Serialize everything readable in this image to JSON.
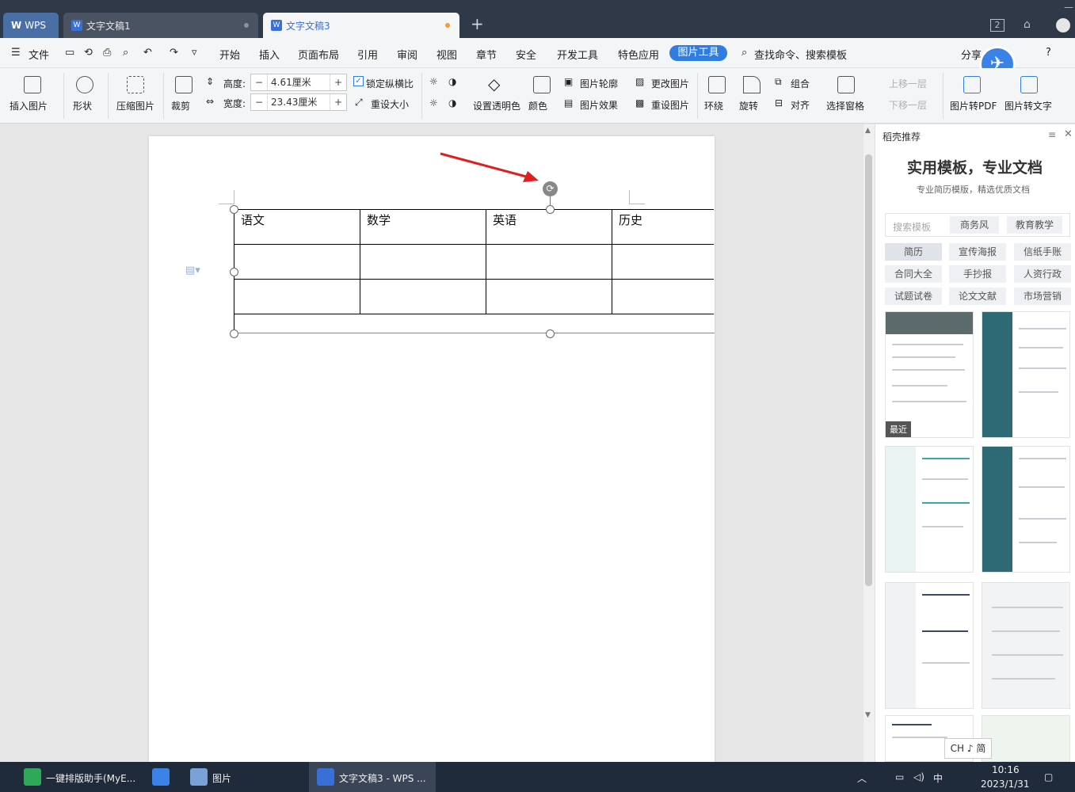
{
  "tabs": [
    {
      "label": "WPS"
    },
    {
      "label": "文字文稿1"
    },
    {
      "label": "文字文稿3"
    }
  ],
  "title_right": {
    "page_count": "2"
  },
  "menu": {
    "file": "文件",
    "items": [
      "开始",
      "插入",
      "页面布局",
      "引用",
      "审阅",
      "视图",
      "章节",
      "安全",
      "开发工具",
      "特色应用"
    ],
    "active": "图片工具",
    "search": "查找命令、搜索模板",
    "share": "分享",
    "help": "?"
  },
  "ribbon": {
    "insert_picture": "插入图片",
    "shape": "形状",
    "compress": "压缩图片",
    "crop": "裁剪",
    "height_label": "高度:",
    "height_value": "4.61厘米",
    "width_label": "宽度:",
    "width_value": "23.43厘米",
    "lock_ratio": "锁定纵横比",
    "reset_size": "重设大小",
    "transparency": "设置透明色",
    "color": "颜色",
    "outline": "图片轮廓",
    "effects": "图片效果",
    "change_picture": "更改图片",
    "reset_picture": "重设图片",
    "wrap": "环绕",
    "rotate": "旋转",
    "group": "组合",
    "align": "对齐",
    "select_pane": "选择窗格",
    "bring_forward": "上移一层",
    "send_backward": "下移一层",
    "to_pdf": "图片转PDF",
    "to_text": "图片转文字"
  },
  "document": {
    "table_headers": [
      "语文",
      "数学",
      "英语",
      "历史"
    ],
    "rows": 2
  },
  "panel": {
    "title": "稻壳推荐",
    "heading": "实用模板，专业文档",
    "subheading": "专业简历模版，精选优质文档",
    "search_placeholder": "搜索模板",
    "quick_tags": [
      "商务风",
      "教育教学"
    ],
    "categories": [
      "简历",
      "宣传海报",
      "信纸手账",
      "合同大全",
      "手抄报",
      "人资行政",
      "试题试卷",
      "论文文献",
      "市场营销"
    ],
    "recent_badge": "最近"
  },
  "ime": {
    "text": "CH ♪ 简"
  },
  "taskbar": {
    "items": [
      "一键排版助手(MyE...",
      "",
      "图片",
      "文字文稿3 - WPS ..."
    ],
    "ime_indicator": "中",
    "time": "10:16",
    "date": "2023/1/31"
  },
  "colors": {
    "accent": "#2f7de1",
    "titlebar": "#2f3947",
    "arrow": "#e02020"
  }
}
